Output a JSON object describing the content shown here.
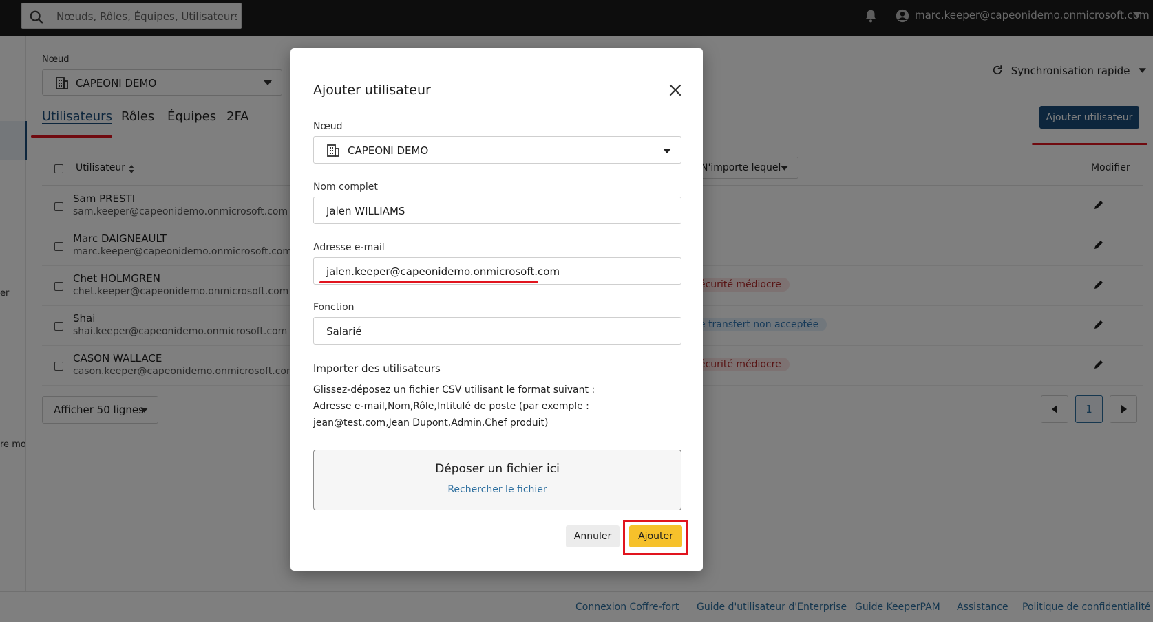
{
  "topbar": {
    "search_placeholder": "Nœuds, Rôles, Équipes, Utilisateurs",
    "account_email": "marc.keeper@capeonidemo.onmicrosoft.com"
  },
  "page": {
    "node_label": "Nœud",
    "node_value": "CAPEONI DEMO",
    "tabs": [
      {
        "label": "Utilisateurs",
        "active": true
      },
      {
        "label": "Rôles",
        "active": false
      },
      {
        "label": "Équipes",
        "active": false
      },
      {
        "label": "2FA",
        "active": false
      }
    ],
    "sync_label": "Synchronisation rapide",
    "add_user_button": "Ajouter utilisateur",
    "table": {
      "col_user": "Utilisateur",
      "filter_any": "N'importe lequel",
      "col_edit": "Modifier",
      "rows": [
        {
          "name": "Sam PRESTI",
          "email": "sam.keeper@capeonidemo.onmicrosoft.com",
          "status": ""
        },
        {
          "name": "Marc DAIGNEAULT",
          "email": "marc.keeper@capeonidemo.onmicrosoft.com",
          "status": ""
        },
        {
          "name": "Chet HOLMGREN",
          "email": "chet.keeper@capeonidemo.onmicrosoft.com",
          "status": "écurité médiocre"
        },
        {
          "name": "Shai",
          "email": "shai.keeper@capeonidemo.onmicrosoft.com",
          "status": "e transfert non acceptée"
        },
        {
          "name": "CASON WALLACE",
          "email": "cason.keeper@capeonidemo.onmicrosoft.com",
          "status": "écurité médiocre"
        }
      ]
    },
    "rows_select": "Afficher 50 lignes",
    "current_page": "1",
    "left_fragments": {
      "a": "er",
      "b": "re mo"
    }
  },
  "footer": {
    "links": [
      "Connexion Coffre-fort",
      "Guide d'utilisateur d'Enterprise",
      "Guide KeeperPAM",
      "Assistance",
      "Politique de confidentialité"
    ]
  },
  "modal": {
    "title": "Ajouter utilisateur",
    "node_label": "Nœud",
    "node_value": "CAPEONI DEMO",
    "fullname_label": "Nom complet",
    "fullname_value": "Jalen WILLIAMS",
    "email_label": "Adresse e-mail",
    "email_value": "jalen.keeper@capeonidemo.onmicrosoft.com",
    "job_label": "Fonction",
    "job_value": "Salarié",
    "import_title": "Importer des utilisateurs",
    "import_line1": "Glissez-déposez un fichier CSV utilisant le format suivant :",
    "import_line2": "Adresse e-mail,Nom,Rôle,Intitulé de poste (par exemple : jean@test.com,Jean Dupont,Admin,Chef produit)",
    "drop_title": "Déposer un fichier ici",
    "drop_link": "Rechercher le fichier",
    "cancel_button": "Annuler",
    "add_button": "Ajouter"
  },
  "colors": {
    "accent": "#1a4d7a",
    "link": "#2c6e9e",
    "primary_button": "#f6c12b",
    "highlight": "#e1141e"
  }
}
